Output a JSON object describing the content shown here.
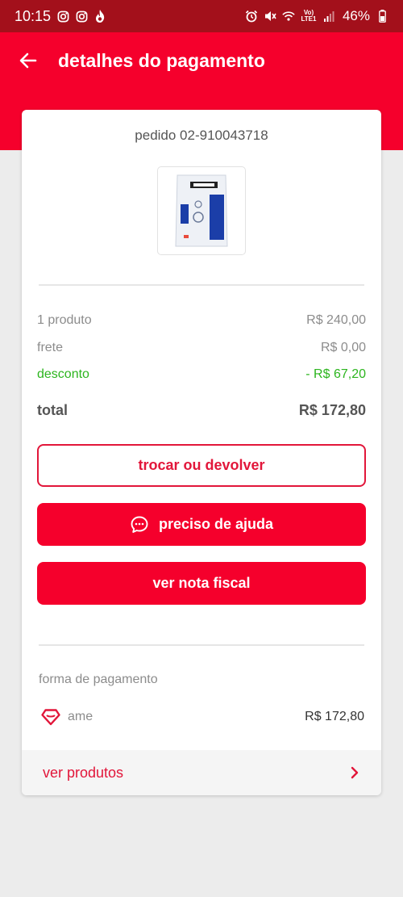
{
  "status_bar": {
    "time": "10:15",
    "battery": "46%",
    "network": "Vo) LTE1",
    "icons": [
      "instagram-icon",
      "instagram-icon",
      "flame-icon",
      "alarm-icon",
      "mute-icon",
      "wifi-icon",
      "signal-icon"
    ]
  },
  "header": {
    "title": "detalhes do pagamento",
    "back_icon": "arrow-left-icon"
  },
  "order": {
    "id_label": "pedido 02-910043718",
    "product_image": "product-thumbnail"
  },
  "summary": {
    "products": {
      "label": "1 produto",
      "value": "R$ 240,00"
    },
    "shipping": {
      "label": "frete",
      "value": "R$ 0,00"
    },
    "discount": {
      "label": "desconto",
      "value": "- R$ 67,20"
    },
    "total": {
      "label": "total",
      "value": "R$ 172,80"
    }
  },
  "actions": {
    "exchange": "trocar ou devolver",
    "help": "preciso de ajuda",
    "invoice": "ver nota fiscal"
  },
  "payment": {
    "title": "forma de pagamento",
    "method": "ame",
    "amount": "R$ 172,80",
    "method_icon": "ame-heart-icon"
  },
  "footer": {
    "link": "ver produtos",
    "icon": "chevron-right-icon"
  },
  "colors": {
    "brand_red": "#f5002c",
    "status_bar": "#a3101b",
    "discount_green": "#2cb51e"
  }
}
